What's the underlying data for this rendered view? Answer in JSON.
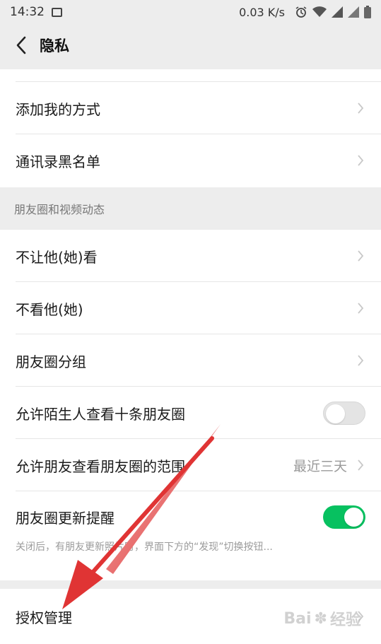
{
  "status_bar": {
    "time": "14:32",
    "network_speed": "0.03 K/s",
    "icons": [
      "image-icon",
      "alarm-icon",
      "wifi-icon",
      "signal-icon",
      "signal-icon",
      "battery-icon"
    ]
  },
  "nav": {
    "back_icon": "chevron-left-icon",
    "title": "隐私"
  },
  "group1": {
    "items": [
      {
        "label": "添加我的方式"
      },
      {
        "label": "通讯录黑名单"
      }
    ]
  },
  "moments_section": {
    "header": "朋友圈和视频动态",
    "items": [
      {
        "label": "不让他(她)看"
      },
      {
        "label": "不看他(她)"
      },
      {
        "label": "朋友圈分组"
      },
      {
        "label": "允许陌生人查看十条朋友圈",
        "toggle": false
      },
      {
        "label": "允许朋友查看朋友圈的范围",
        "value": "最近三天"
      },
      {
        "label": "朋友圈更新提醒",
        "toggle": true,
        "description": "关闭后，有朋友更新照片时，界面下方的“发现”切换按钮..."
      }
    ]
  },
  "group3": {
    "items": [
      {
        "label": "授权管理"
      }
    ]
  },
  "watermark": {
    "text_left": "Bai",
    "text_right": "经验"
  },
  "colors": {
    "background": "#ededed",
    "toggle_on": "#07c160",
    "arrow": "#e03434"
  }
}
